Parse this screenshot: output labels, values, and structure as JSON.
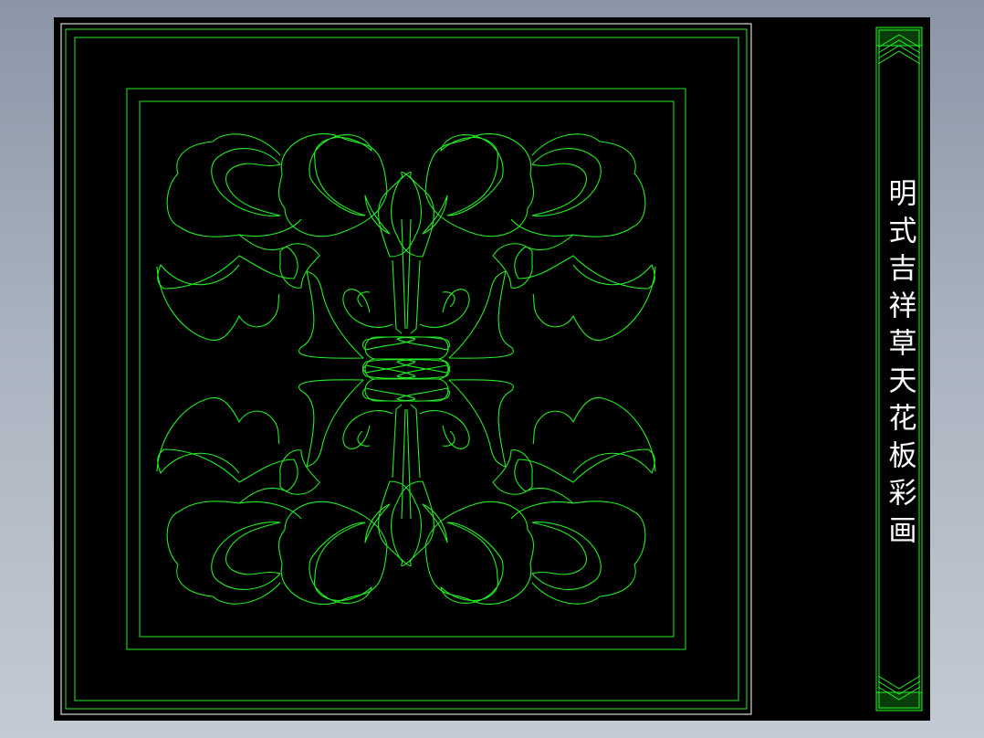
{
  "title": "明式吉祥草天花板彩画",
  "colors": {
    "line": "#22ee22",
    "background": "#000000",
    "frame": "#ffffff",
    "desktop": "#a0aab7"
  }
}
